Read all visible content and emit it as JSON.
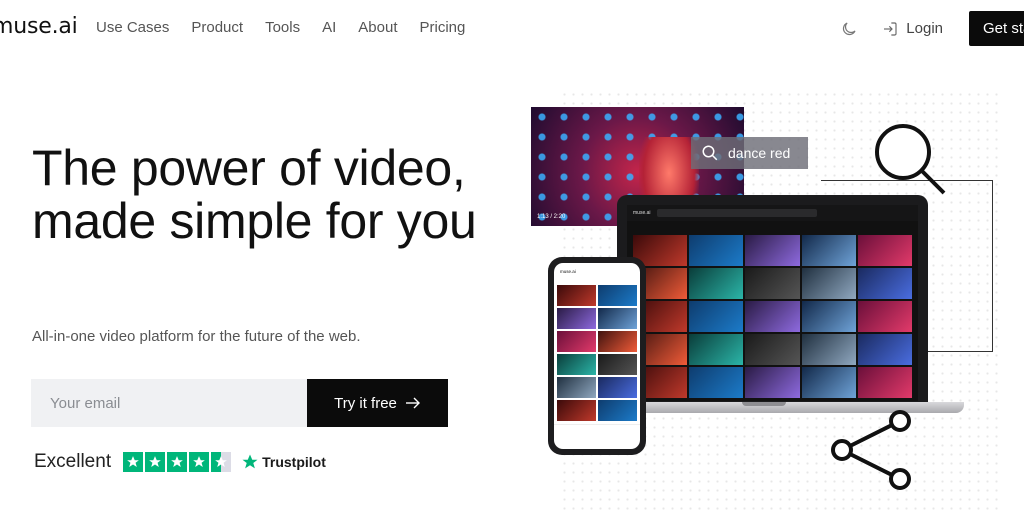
{
  "nav": {
    "logo": "muse.ai",
    "links": [
      "Use Cases",
      "Product",
      "Tools",
      "AI",
      "About",
      "Pricing"
    ],
    "login": "Login",
    "cta": "Get started"
  },
  "hero": {
    "headline": "The power of video, made simple for you",
    "subhead": "All-in-one video platform for the future of the web.",
    "email_placeholder": "Your email",
    "try_button": "Try it free",
    "rating_label": "Excellent",
    "trustpilot": "Trustpilot",
    "rating_stars": 4.5
  },
  "graphic": {
    "search_query": "dance red",
    "video_time": "1:13 / 2:20"
  },
  "colors": {
    "primary_button": "#0b0b0b",
    "trustpilot_green": "#00b67a",
    "input_bg": "#f0f1f3"
  },
  "icons": [
    "moon-icon",
    "login-icon",
    "arrow-right-icon",
    "star-icon",
    "search-icon",
    "share-icon"
  ]
}
